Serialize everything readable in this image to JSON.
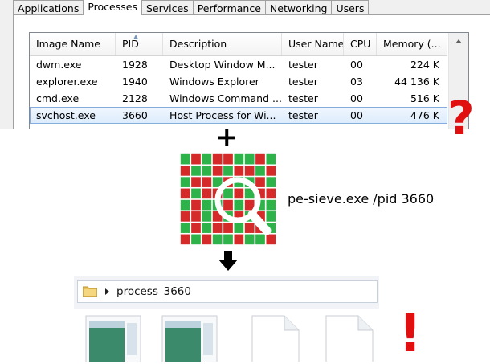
{
  "taskmgr": {
    "tabs": [
      "Applications",
      "Processes",
      "Services",
      "Performance",
      "Networking",
      "Users"
    ],
    "active_tab": "Processes",
    "columns": [
      "Image Name",
      "PID",
      "Description",
      "User Name",
      "CPU",
      "Memory (..."
    ],
    "rows": [
      [
        "dwm.exe",
        "1928",
        "Desktop Window M...",
        "tester",
        "00",
        "224 K"
      ],
      [
        "explorer.exe",
        "1940",
        "Windows Explorer",
        "tester",
        "03",
        "44 136 K"
      ],
      [
        "cmd.exe",
        "2128",
        "Windows Command ...",
        "tester",
        "00",
        "516 K"
      ],
      [
        "svchost.exe",
        "3660",
        "Host Process for Wi...",
        "tester",
        "00",
        "476 K"
      ]
    ],
    "selected_row": 3
  },
  "marks": {
    "question": "?",
    "plus": "+",
    "exclaim": "!"
  },
  "tool": {
    "icon": "pe-sieve-grid-magnifier-icon",
    "command": "pe-sieve.exe /pid 3660",
    "colors": {
      "red": "#d42a2a",
      "green": "#2eb24a"
    }
  },
  "explorer": {
    "path": "process_3660",
    "files": [
      "image-file-icon",
      "image-file-icon",
      "blank-file-icon",
      "blank-file-icon"
    ]
  }
}
